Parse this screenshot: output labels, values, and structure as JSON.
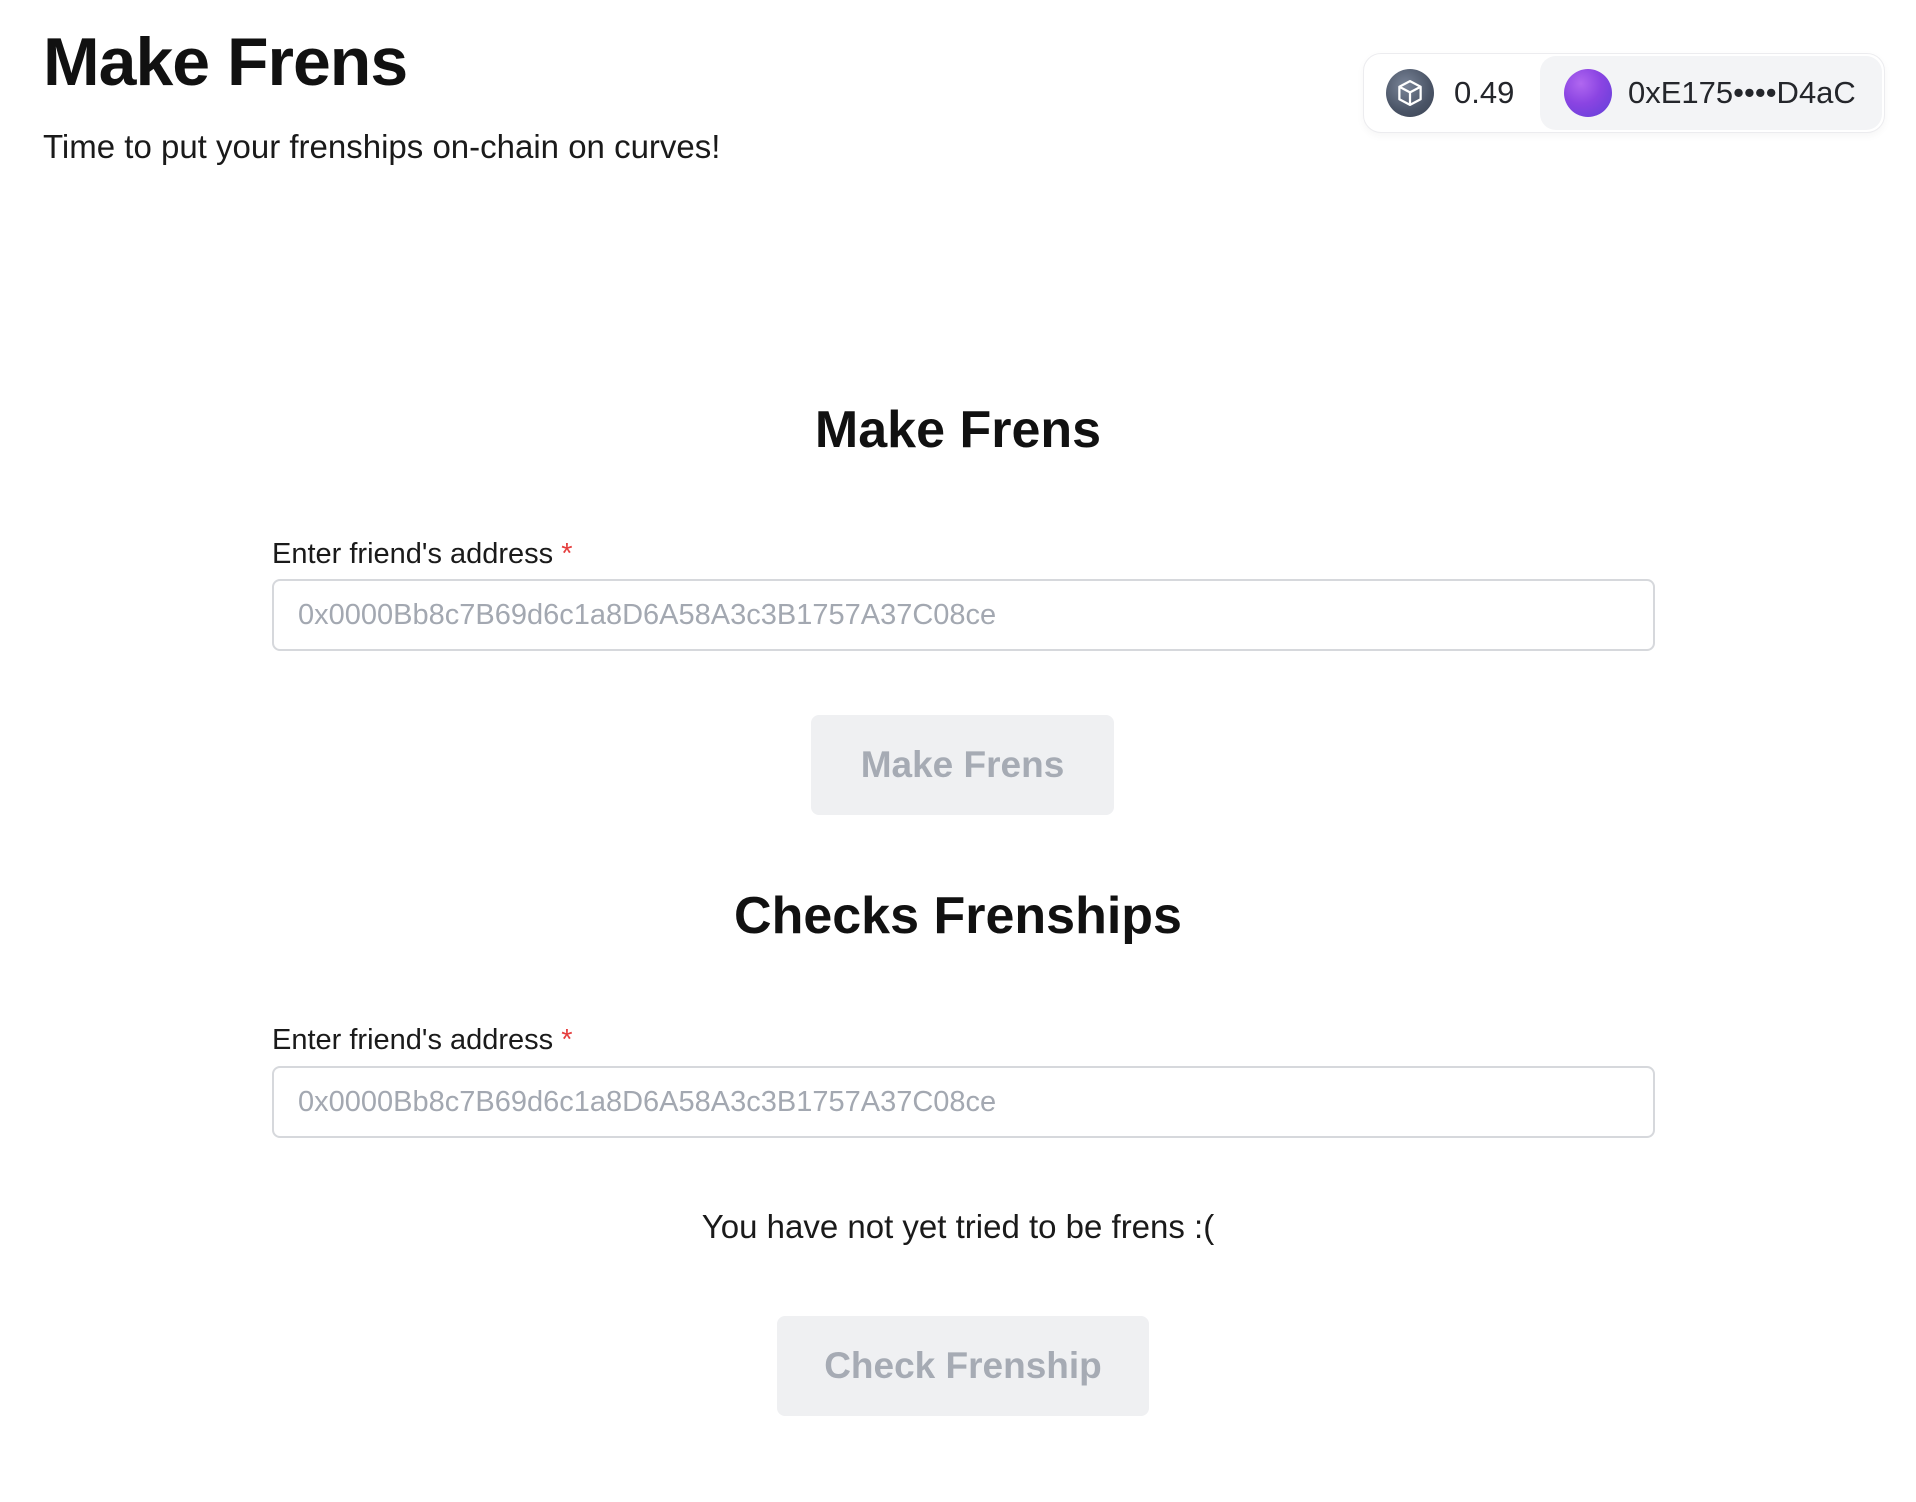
{
  "header": {
    "title": "Make Frens",
    "subtitle": "Time to put your frenships on-chain on curves!"
  },
  "wallet": {
    "chain_icon": "cube-icon",
    "balance": "0.49",
    "address": "0xE175••••D4aC"
  },
  "make_frens": {
    "title": "Make Frens",
    "label": "Enter friend's address",
    "required_mark": "*",
    "placeholder": "0x0000Bb8c7B69d6c1a8D6A58A3c3B1757A37C08ce",
    "value": "",
    "button_label": "Make Frens"
  },
  "check_frenships": {
    "title": "Checks Frenships",
    "label": "Enter friend's address",
    "required_mark": "*",
    "placeholder": "0x0000Bb8c7B69d6c1a8D6A58A3c3B1757A37C08ce",
    "value": "",
    "status": "You have not yet tried to be frens :(",
    "button_label": "Check Frenship"
  },
  "colors": {
    "required": "#e53e3e",
    "button_disabled_bg": "#eff0f2",
    "button_disabled_text": "#a6abb4",
    "avatar": "#8a44e2"
  }
}
